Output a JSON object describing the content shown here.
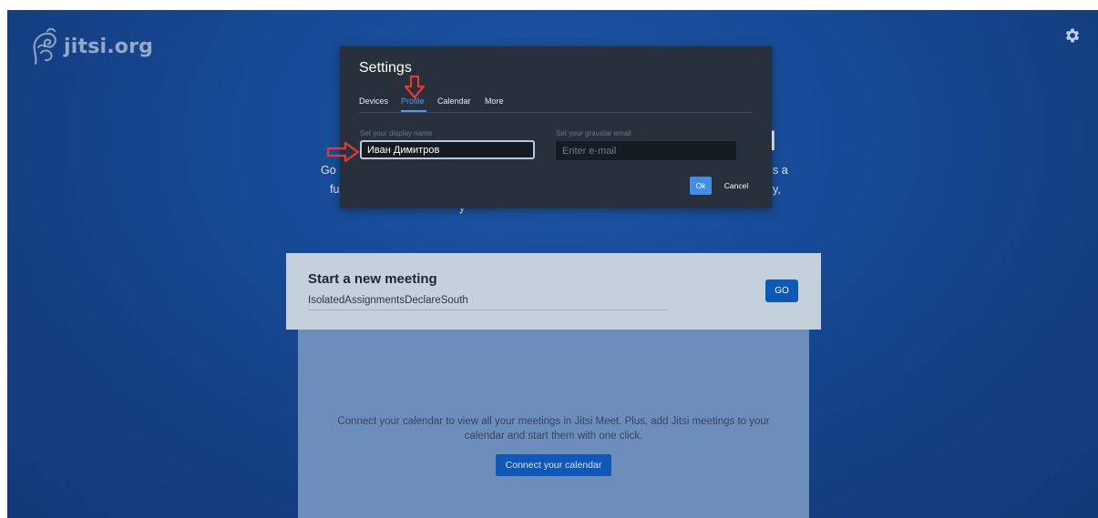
{
  "brand": {
    "logo_text": "jitsi.org"
  },
  "colors": {
    "accent": "#4f9cf2",
    "primary_button": "#0e59b8",
    "background": "#174a96",
    "dialog": "#27303b",
    "annotation_arrow": "#e53935"
  },
  "icons": {
    "settings": "gear-icon",
    "logo": "jitsi-logo-icon",
    "annotation": "red-arrow-icon"
  },
  "hero": {
    "title_left": "G",
    "title_right": "l",
    "desc_l1_left": "Go",
    "desc_l1_right": "s a",
    "desc_l2_left": "fu",
    "desc_l2_right": "y,",
    "desc_l3": "y"
  },
  "settings_dialog": {
    "title": "Settings",
    "tabs": [
      {
        "label": "Devices",
        "active": false
      },
      {
        "label": "Profile",
        "active": true
      },
      {
        "label": "Calendar",
        "active": false
      },
      {
        "label": "More",
        "active": false
      }
    ],
    "display_name_label": "Set your display name",
    "display_name_value": "Иван Димитров",
    "gravatar_label": "Set your gravatar email",
    "gravatar_placeholder": "Enter e-mail",
    "ok_label": "Ok",
    "cancel_label": "Cancel"
  },
  "welcome": {
    "title": "Start a new meeting",
    "room_name": "IsolatedAssignmentsDeclareSouth",
    "go_label": "GO"
  },
  "calendar": {
    "description_line1": "Connect your calendar to view all your meetings in Jitsi Meet. Plus, add Jitsi meetings to your",
    "description_line2": "calendar and start them with one click.",
    "button_label": "Connect your calendar"
  }
}
